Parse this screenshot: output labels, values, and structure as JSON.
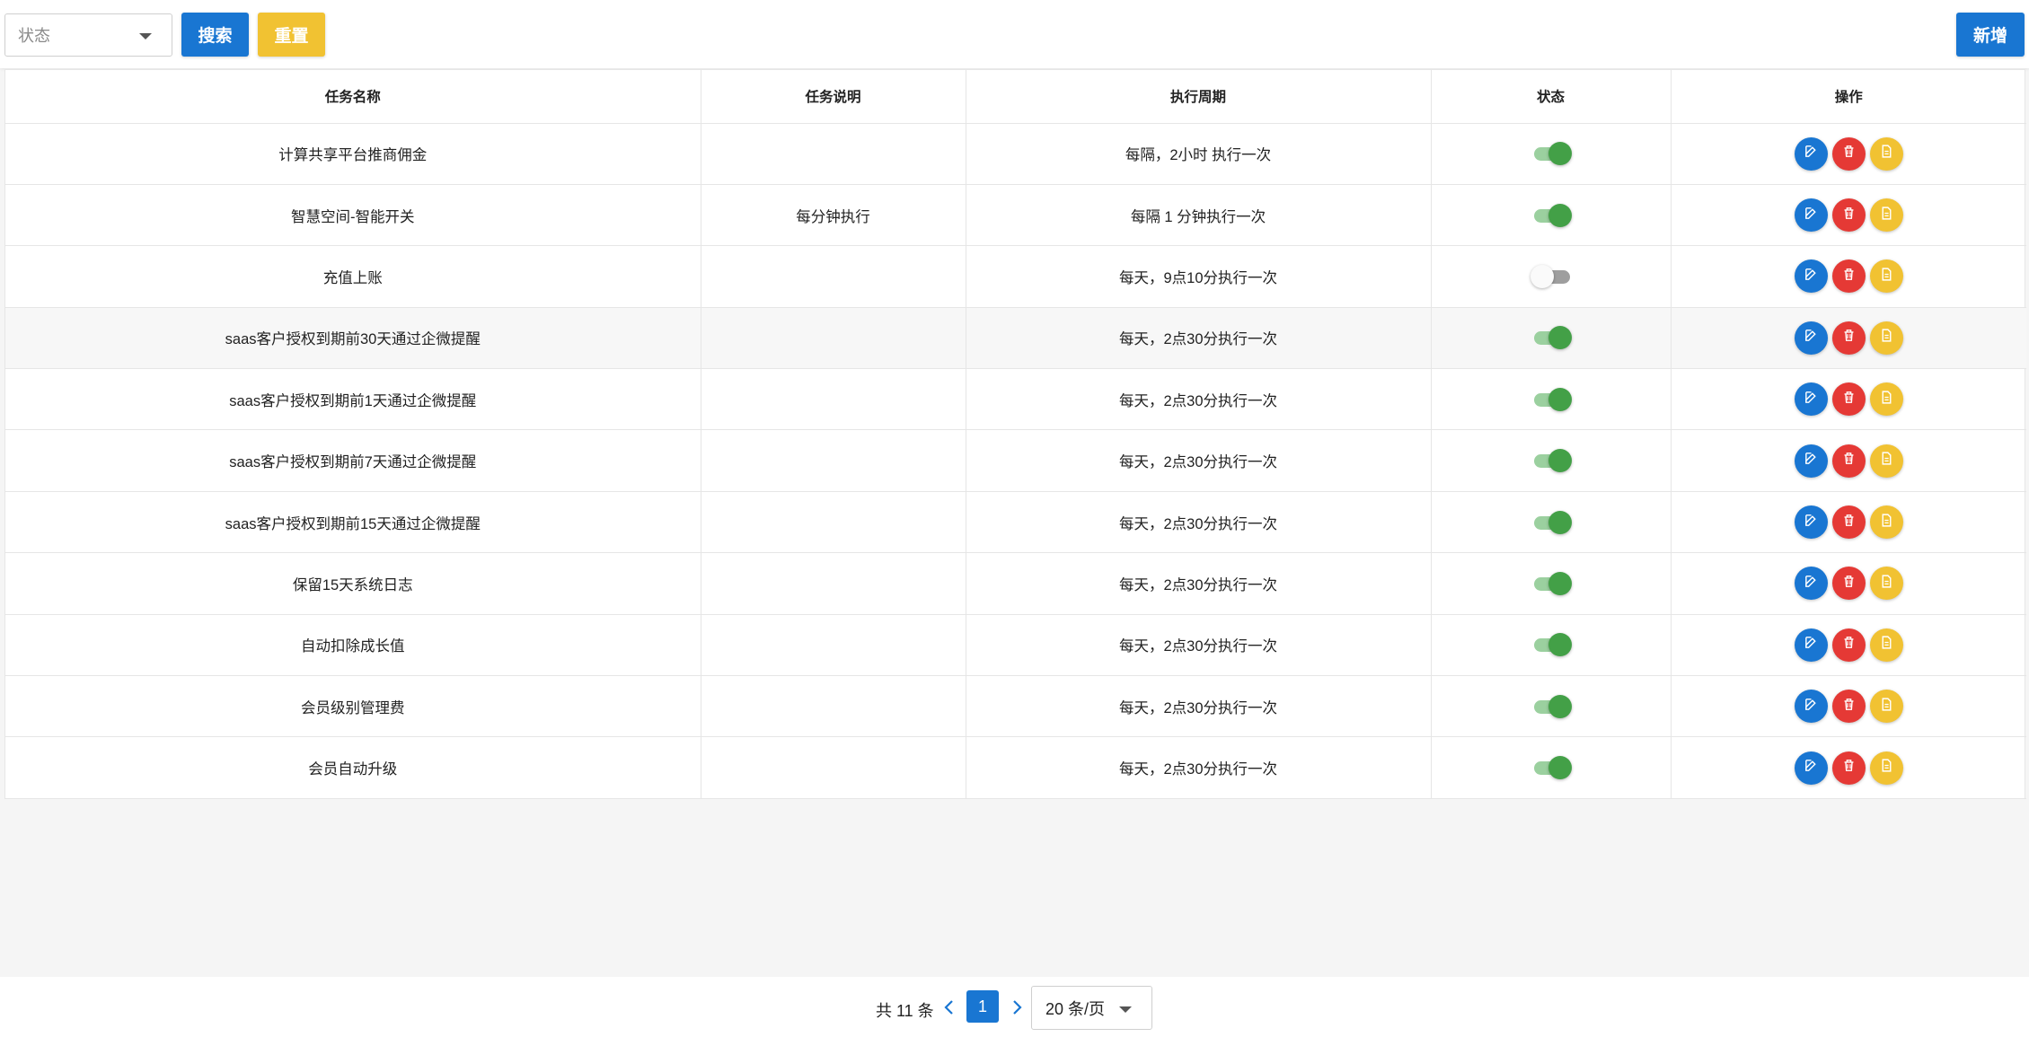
{
  "toolbar": {
    "status_placeholder": "状态",
    "search_label": "搜索",
    "reset_label": "重置",
    "add_label": "新增"
  },
  "colors": {
    "primary": "#1976d2",
    "warning": "#f1c232",
    "danger": "#e53935",
    "switch_on": "#43a047"
  },
  "table": {
    "headers": [
      "任务名称",
      "任务说明",
      "执行周期",
      "状态",
      "操作"
    ],
    "rows": [
      {
        "name": "计算共享平台推商佣金",
        "desc": "",
        "cycle": "每隔，2小时 执行一次",
        "enabled": true
      },
      {
        "name": "智慧空间-智能开关",
        "desc": "每分钟执行",
        "cycle": "每隔 1 分钟执行一次",
        "enabled": true
      },
      {
        "name": "充值上账",
        "desc": "",
        "cycle": "每天，9点10分执行一次",
        "enabled": false
      },
      {
        "name": "saas客户授权到期前30天通过企微提醒",
        "desc": "",
        "cycle": "每天，2点30分执行一次",
        "enabled": true
      },
      {
        "name": "saas客户授权到期前1天通过企微提醒",
        "desc": "",
        "cycle": "每天，2点30分执行一次",
        "enabled": true
      },
      {
        "name": "saas客户授权到期前7天通过企微提醒",
        "desc": "",
        "cycle": "每天，2点30分执行一次",
        "enabled": true
      },
      {
        "name": "saas客户授权到期前15天通过企微提醒",
        "desc": "",
        "cycle": "每天，2点30分执行一次",
        "enabled": true
      },
      {
        "name": "保留15天系统日志",
        "desc": "",
        "cycle": "每天，2点30分执行一次",
        "enabled": true
      },
      {
        "name": "自动扣除成长值",
        "desc": "",
        "cycle": "每天，2点30分执行一次",
        "enabled": true
      },
      {
        "name": "会员级别管理费",
        "desc": "",
        "cycle": "每天，2点30分执行一次",
        "enabled": true
      },
      {
        "name": "会员自动升级",
        "desc": "",
        "cycle": "每天，2点30分执行一次",
        "enabled": true
      }
    ],
    "action_icons": [
      "edit-icon",
      "trash-icon",
      "document-icon"
    ]
  },
  "pagination": {
    "total_label": "共 11 条",
    "current_page": "1",
    "page_size_label": "20 条/页"
  }
}
